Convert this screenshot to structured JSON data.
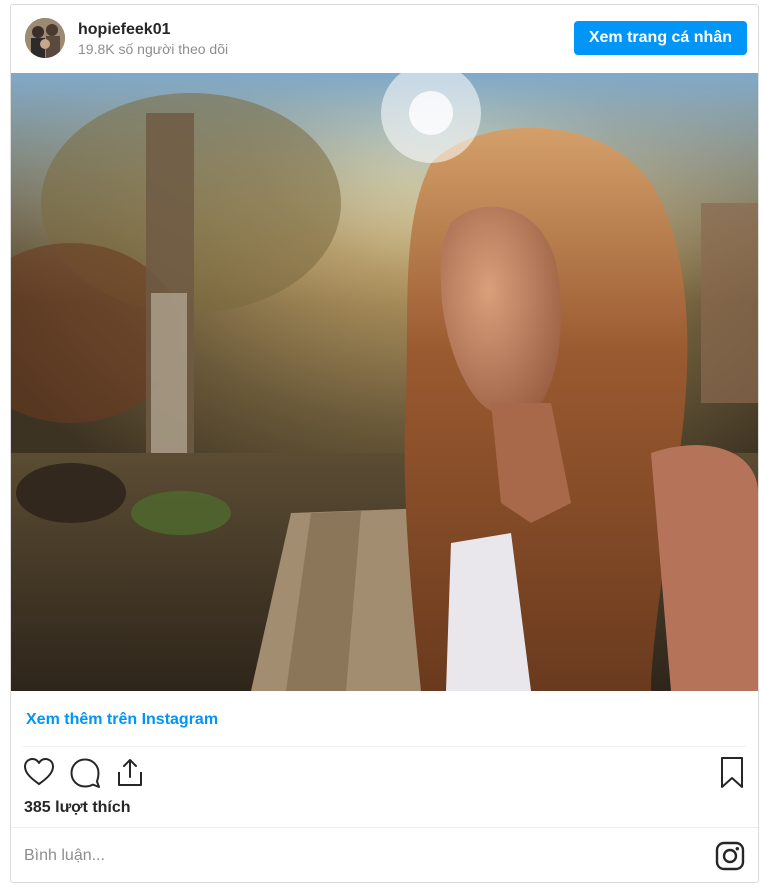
{
  "header": {
    "username": "hopiefeek01",
    "followers": "19.8K số người theo dõi",
    "profile_button": "Xem trang cá nhân"
  },
  "post": {
    "image_icon": "photo",
    "more_link": "Xem thêm trên Instagram",
    "likes": "385 lượt thích",
    "comment_placeholder": "Bình luận..."
  },
  "icons": {
    "like": "heart-icon",
    "comment": "comment-icon",
    "share": "share-icon",
    "save": "bookmark-icon",
    "brand": "instagram-icon"
  },
  "colors": {
    "accent": "#0095f6",
    "text": "#262626",
    "muted": "#8e8e8e",
    "border": "#dbdbdb"
  }
}
